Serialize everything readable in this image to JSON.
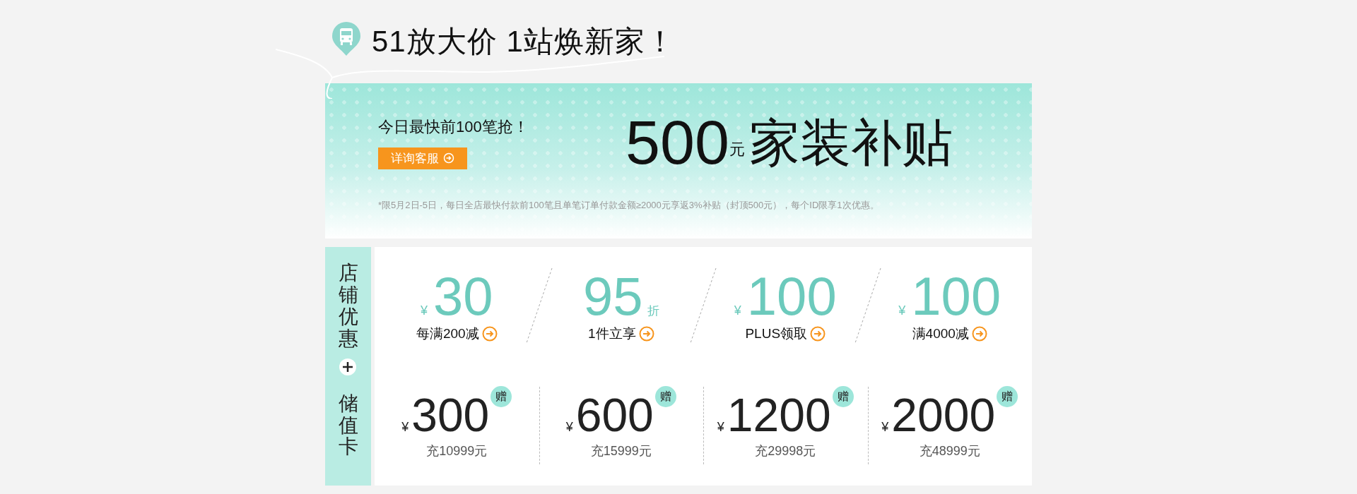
{
  "header": {
    "title": "51放大价 1站焕新家！"
  },
  "banner": {
    "headline": "今日最快前100笔抢！",
    "button": "详询客服",
    "amount": "500",
    "amount_unit": "元",
    "subject": "家装补贴",
    "note": "*限5月2日-5日，每日全店最快付款前100笔且单笔订单付款金额≥2000元享返3%补贴（封顶500元），每个ID限享1次优惠。"
  },
  "coupons": {
    "heading": "店铺优惠",
    "items": [
      {
        "kind": "amount",
        "currency": "¥",
        "value": "30",
        "label": "每满200减"
      },
      {
        "kind": "discount",
        "value": "95",
        "unit": "折",
        "label": "1件立享"
      },
      {
        "kind": "amount",
        "currency": "¥",
        "value": "100",
        "label": "PLUS领取"
      },
      {
        "kind": "amount",
        "currency": "¥",
        "value": "100",
        "label": "满4000减"
      }
    ]
  },
  "cards": {
    "heading": "储值卡",
    "items": [
      {
        "currency": "¥",
        "value": "300",
        "badge": "赠",
        "label": "充10999元"
      },
      {
        "currency": "¥",
        "value": "600",
        "badge": "赠",
        "label": "充15999元"
      },
      {
        "currency": "¥",
        "value": "1200",
        "badge": "赠",
        "label": "充29998元"
      },
      {
        "currency": "¥",
        "value": "2000",
        "badge": "赠",
        "label": "充48999元"
      }
    ]
  }
}
